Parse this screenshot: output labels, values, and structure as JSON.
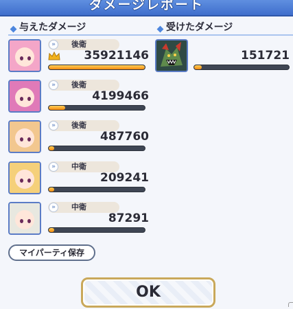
{
  "title": "ダメージレポート",
  "dealt_header": "与えたダメージ",
  "taken_header": "受けたダメージ",
  "dealt": [
    {
      "role": "後衛",
      "damage": "35921146",
      "bar": 1.0,
      "top": true,
      "hair": "#f4a6c8"
    },
    {
      "role": "後衛",
      "damage": "4199466",
      "bar": 0.17,
      "top": false,
      "hair": "#e07ab8"
    },
    {
      "role": "後衛",
      "damage": "487760",
      "bar": 0.02,
      "top": false,
      "hair": "#f2c78f"
    },
    {
      "role": "中衛",
      "damage": "209241",
      "bar": 0.01,
      "top": false,
      "hair": "#f5d07a"
    },
    {
      "role": "中衛",
      "damage": "87291",
      "bar": 0.005,
      "top": false,
      "hair": "#e8e8e0"
    }
  ],
  "taken": [
    {
      "damage": "151721",
      "bar": 0.08
    }
  ],
  "buttons": {
    "party_save": "マイパーティ保存",
    "ok": "OK"
  },
  "colors": {
    "accent": "#3f6ecc",
    "bar_fill": "#f58a0e",
    "bar_track": "#3f4654"
  }
}
